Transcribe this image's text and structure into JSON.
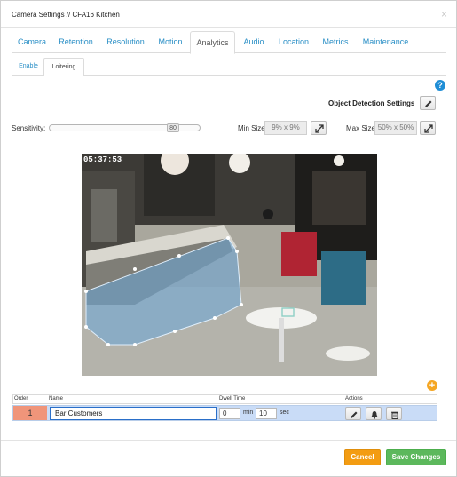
{
  "window": {
    "title": "Camera Settings // CFA16 Kitchen",
    "close_glyph": "×"
  },
  "tabs": [
    {
      "label": "Camera"
    },
    {
      "label": "Retention"
    },
    {
      "label": "Resolution"
    },
    {
      "label": "Motion"
    },
    {
      "label": "Analytics",
      "active": true
    },
    {
      "label": "Audio"
    },
    {
      "label": "Location"
    },
    {
      "label": "Metrics"
    },
    {
      "label": "Maintenance"
    }
  ],
  "subtabs": [
    {
      "label": "Enable"
    },
    {
      "label": "Loitering",
      "active": true
    }
  ],
  "help_glyph": "?",
  "object_detection": {
    "label": "Object Detection Settings",
    "edit_icon": "pencil-icon"
  },
  "sensitivity": {
    "label": "Sensitivity:",
    "value": "80",
    "level": 0.8
  },
  "min_size": {
    "label": "Min Size:",
    "value": "9% x 9%"
  },
  "max_size": {
    "label": "Max Size:",
    "value": "50% x 50%"
  },
  "camera": {
    "timestamp": "05:37:53"
  },
  "zones": {
    "add_glyph": "+",
    "headers": {
      "order": "Order",
      "name": "Name",
      "dwell": "Dwell Time",
      "actions": "Actions"
    },
    "rows": [
      {
        "order": "1",
        "name": "Bar Customers",
        "min": "0",
        "min_unit": "min",
        "sec": "10",
        "sec_unit": "sec"
      }
    ]
  },
  "footer": {
    "cancel": "Cancel",
    "save": "Save Changes"
  },
  "colors": {
    "accent": "#2a8fc6",
    "cancel": "#f39c12",
    "save": "#5cb85c",
    "row": "#c9dcf7",
    "order": "#f0957a",
    "zone_fill": "#6aa6d8"
  }
}
